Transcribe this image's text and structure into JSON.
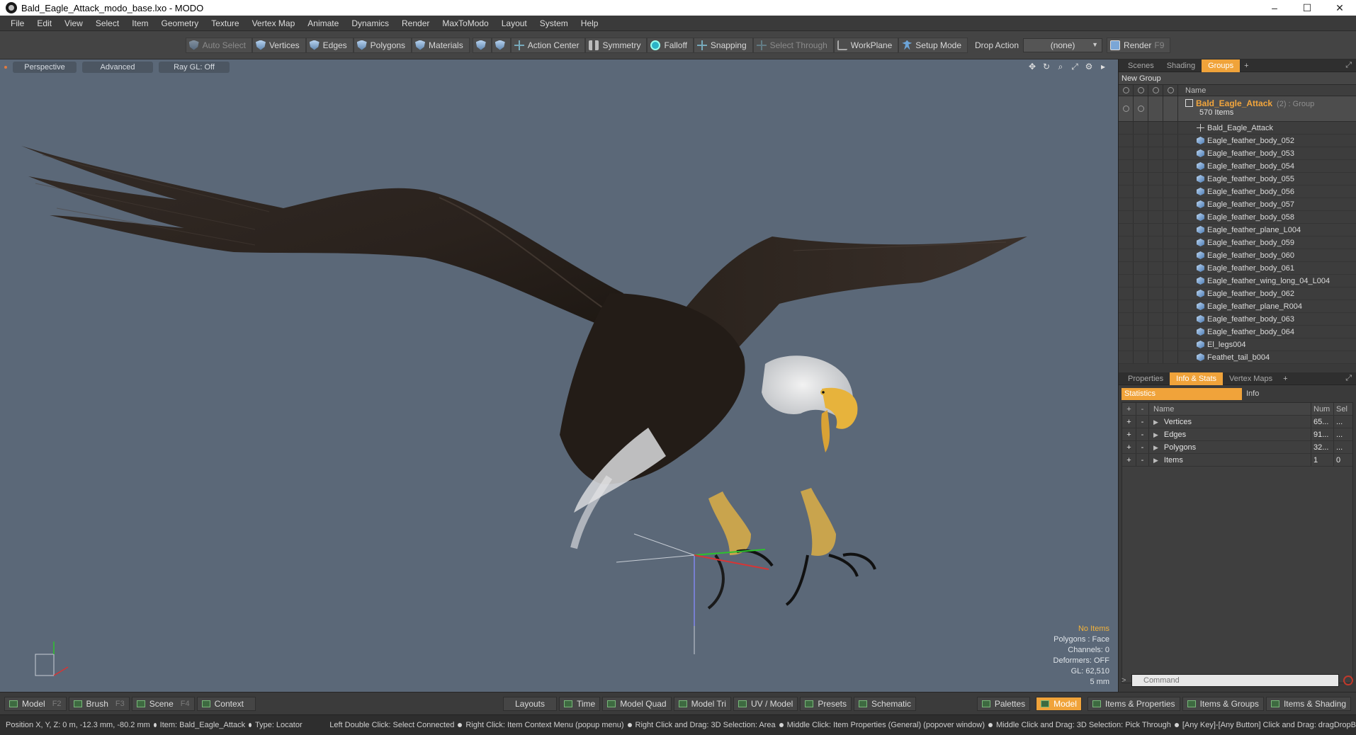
{
  "window": {
    "title": "Bald_Eagle_Attack_modo_base.lxo - MODO",
    "controls": [
      "–",
      "☐",
      "✕"
    ]
  },
  "menu": [
    "File",
    "Edit",
    "View",
    "Select",
    "Item",
    "Geometry",
    "Texture",
    "Vertex Map",
    "Animate",
    "Dynamics",
    "Render",
    "MaxToModo",
    "Layout",
    "System",
    "Help"
  ],
  "toolbar": {
    "auto_select": "Auto Select",
    "vertices": "Vertices",
    "edges": "Edges",
    "polygons": "Polygons",
    "materials": "Materials",
    "action_center": "Action Center",
    "symmetry": "Symmetry",
    "falloff": "Falloff",
    "snapping": "Snapping",
    "select_through": "Select Through",
    "workplane": "WorkPlane",
    "setup_mode": "Setup Mode",
    "drop_action_label": "Drop Action",
    "drop_action_value": "(none)",
    "render": "Render",
    "render_key": "F9"
  },
  "viewport": {
    "view_mode": "Perspective",
    "advanced": "Advanced",
    "raygl": "Ray GL: Off",
    "background_color": "#5b6878",
    "stats": {
      "no_items": "No Items",
      "polygons": "Polygons : Face",
      "channels": "Channels: 0",
      "deformers": "Deformers: OFF",
      "gl": "GL: 62,510",
      "unit": "5 mm"
    }
  },
  "scene_panel": {
    "tabs": [
      "Scenes",
      "Shading",
      "Groups"
    ],
    "active_tab": "Groups",
    "new_group": "New Group",
    "name_header": "Name",
    "group": {
      "name": "Bald_Eagle_Attack",
      "type": "(2) : Group",
      "count": "570 Items"
    },
    "items": [
      {
        "name": "Bald_Eagle_Attack",
        "kind": "locator"
      },
      {
        "name": "Eagle_feather_body_052",
        "kind": "mesh"
      },
      {
        "name": "Eagle_feather_body_053",
        "kind": "mesh"
      },
      {
        "name": "Eagle_feather_body_054",
        "kind": "mesh"
      },
      {
        "name": "Eagle_feather_body_055",
        "kind": "mesh"
      },
      {
        "name": "Eagle_feather_body_056",
        "kind": "mesh"
      },
      {
        "name": "Eagle_feather_body_057",
        "kind": "mesh"
      },
      {
        "name": "Eagle_feather_body_058",
        "kind": "mesh"
      },
      {
        "name": "Eagle_feather_plane_L004",
        "kind": "mesh"
      },
      {
        "name": "Eagle_feather_body_059",
        "kind": "mesh"
      },
      {
        "name": "Eagle_feather_body_060",
        "kind": "mesh"
      },
      {
        "name": "Eagle_feather_body_061",
        "kind": "mesh"
      },
      {
        "name": "Eagle_feather_wing_long_04_L004",
        "kind": "mesh"
      },
      {
        "name": "Eagle_feather_body_062",
        "kind": "mesh"
      },
      {
        "name": "Eagle_feather_plane_R004",
        "kind": "mesh"
      },
      {
        "name": "Eagle_feather_body_063",
        "kind": "mesh"
      },
      {
        "name": "Eagle_feather_body_064",
        "kind": "mesh"
      },
      {
        "name": "El_legs004",
        "kind": "mesh"
      },
      {
        "name": "Feathet_tail_b004",
        "kind": "mesh"
      }
    ]
  },
  "info_panel": {
    "tabs": [
      "Properties",
      "Info & Stats",
      "Vertex Maps"
    ],
    "active_tab": "Info & Stats",
    "sub_tabs": [
      "Statistics",
      "Info"
    ],
    "headers": {
      "add": "+",
      "remove": "-",
      "name": "Name",
      "num": "Num",
      "sel": "Sel"
    },
    "rows": [
      {
        "name": "Vertices",
        "num": "65...",
        "sel": "..."
      },
      {
        "name": "Edges",
        "num": "91...",
        "sel": "..."
      },
      {
        "name": "Polygons",
        "num": "32...",
        "sel": "..."
      },
      {
        "name": "Items",
        "num": "1",
        "sel": "0"
      }
    ],
    "command_placeholder": "Command"
  },
  "layoutbar": {
    "left": [
      {
        "label": "Model",
        "key": "F2"
      },
      {
        "label": "Brush",
        "key": "F3"
      },
      {
        "label": "Scene",
        "key": "F4"
      },
      {
        "label": "Context",
        "key": ""
      }
    ],
    "center": [
      "Layouts",
      "Time",
      "Model Quad",
      "Model Tri",
      "UV / Model",
      "Presets",
      "Schematic"
    ],
    "right": [
      "Palettes",
      "Model",
      "Items & Properties",
      "Items & Groups",
      "Items & Shading"
    ]
  },
  "statusbar": {
    "position": "Position X, Y, Z:   0 m, -12.3 mm, -80.2 mm",
    "item": "Item:  Bald_Eagle_Attack",
    "type": "Type:  Locator",
    "hints": [
      "Left Double Click: Select Connected",
      "Right Click: Item Context Menu (popup menu)",
      "Right Click and Drag: 3D Selection: Area",
      "Middle Click: Item Properties (General) (popover window)",
      "Middle Click and Drag: 3D Selection: Pick Through",
      "[Any Key]-[Any Button] Click and Drag: dragDropB"
    ]
  }
}
